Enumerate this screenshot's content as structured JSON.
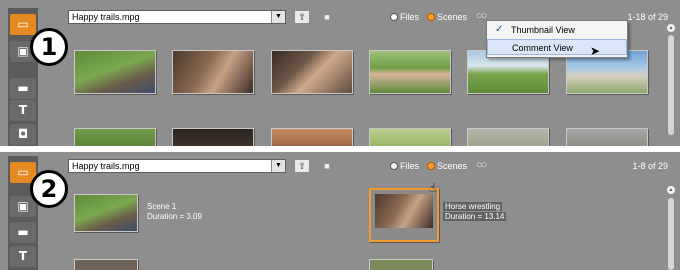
{
  "colors": {
    "panel_bg": "#8e8e8e",
    "sidebar_bg": "#5b5b5b",
    "accent": "#e58a22",
    "menu_bg": "#f4f4f4",
    "menu_hover": "#d9e6f7"
  },
  "sidebar_icons": [
    "clapper-folder-icon",
    "photo-icon",
    "titles-icon",
    "text-icon",
    "camera-icon"
  ],
  "sidebar_glyphs": {
    "text": "T"
  },
  "panel1": {
    "step_number": "1",
    "file_select": "Happy trails.mpg",
    "radio_files": "Files",
    "radio_scenes": "Scenes",
    "range": "1-18 of 29",
    "menu": {
      "thumbnail_view": "Thumbnail View",
      "comment_view": "Comment View",
      "check": "✓"
    }
  },
  "panel2": {
    "step_number": "2",
    "file_select": "Happy trails.mpg",
    "radio_files": "Files",
    "radio_scenes": "Scenes",
    "range": "1-8 of 29",
    "scenes": [
      {
        "title": "Scene 1",
        "duration": "Duration = 3.09"
      },
      {
        "title": "Horse wrestling",
        "duration": "Duration = 13.14"
      }
    ]
  }
}
